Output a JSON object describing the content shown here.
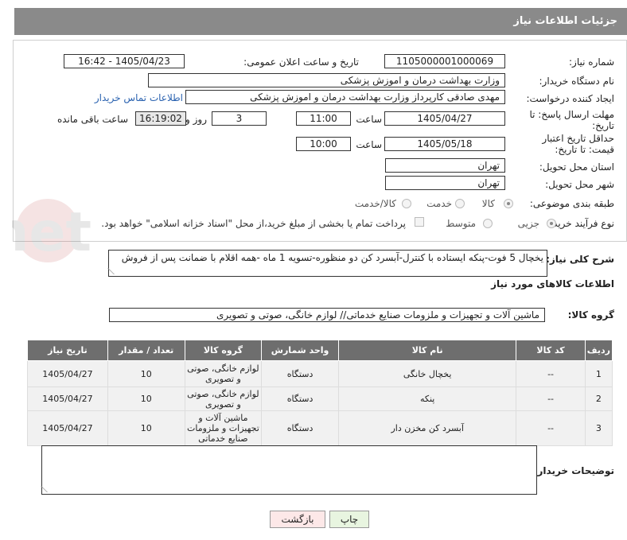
{
  "header": {
    "title": "جزئیات اطلاعات نیاز"
  },
  "form": {
    "need_number_label": "شماره نیاز:",
    "need_number": "1105000001000069",
    "announce_label": "تاریخ و ساعت اعلان عمومی:",
    "announce_value": "1405/04/23 - 16:42",
    "buyer_org_label": "نام دستگاه خریدار:",
    "buyer_org": "وزارت بهداشت  درمان و اموزش پزشکی",
    "creator_label": "ایجاد کننده درخواست:",
    "creator": "مهدی صادقی کارپرداز وزارت بهداشت  درمان و اموزش پزشکی",
    "contact_link": "اطلاعات تماس خریدار",
    "deadline_label": "مهلت ارسال پاسخ: تا تاریخ:",
    "deadline_date": "1405/04/27",
    "time_label": "ساعت",
    "deadline_time": "11:00",
    "days_value": "3",
    "days_label": "روز و",
    "remaining_time": "16:19:02",
    "remaining_label": "ساعت باقی مانده",
    "validity_label": "حداقل تاریخ اعتبار قیمت: تا تاریخ:",
    "validity_date": "1405/05/18",
    "validity_time": "10:00",
    "province_label": "استان محل تحویل:",
    "province": "تهران",
    "city_label": "شهر محل تحویل:",
    "city": "تهران",
    "category_label": "طبقه بندی موضوعی:",
    "category_options": [
      "کالا",
      "خدمت",
      "کالا/خدمت"
    ],
    "process_label": "نوع فرآیند خرید :",
    "process_options": [
      "جزیی",
      "متوسط"
    ],
    "payment_note": "پرداخت تمام یا بخشی از مبلغ خرید،از محل \"اسناد خزانه اسلامی\" خواهد بود."
  },
  "description": {
    "label": "شرح کلی نیاز:",
    "text": "یخچال 5 فوت-پنکه ایستاده با کنترل-آبسرد کن دو منظوره-تسویه 1 ماه -همه اقلام با ضمانت پس از فروش"
  },
  "goods": {
    "section_title": "اطلاعات کالاهای مورد نیاز",
    "group_label": "گروه کالا:",
    "group_value": "ماشین آلات و تجهیزات و ملزومات صنایع خدماتی// لوازم خانگی، صوتی و تصویری",
    "columns": [
      "ردیف",
      "کد کالا",
      "نام کالا",
      "واحد شمارش",
      "گروه کالا",
      "تعداد / مقدار",
      "تاریخ نیاز"
    ],
    "rows": [
      {
        "row": "1",
        "code": "--",
        "name": "یخچال خانگی",
        "unit": "دستگاه",
        "group": "لوازم خانگی، صوتی و تصویری",
        "qty": "10",
        "date": "1405/04/27"
      },
      {
        "row": "2",
        "code": "--",
        "name": "پنکه",
        "unit": "دستگاه",
        "group": "لوازم خانگی، صوتی و تصویری",
        "qty": "10",
        "date": "1405/04/27"
      },
      {
        "row": "3",
        "code": "--",
        "name": "آبسرد کن مخزن دار",
        "unit": "دستگاه",
        "group": "ماشین آلات و تجهیزات و ملزومات صنایع خدماتی",
        "qty": "10",
        "date": "1405/04/27"
      }
    ]
  },
  "buyer_notes_label": "توضیحات خریدار:",
  "buttons": {
    "print": "چاپ",
    "back": "بازگشت"
  },
  "watermark_text": "AriaTender.net"
}
